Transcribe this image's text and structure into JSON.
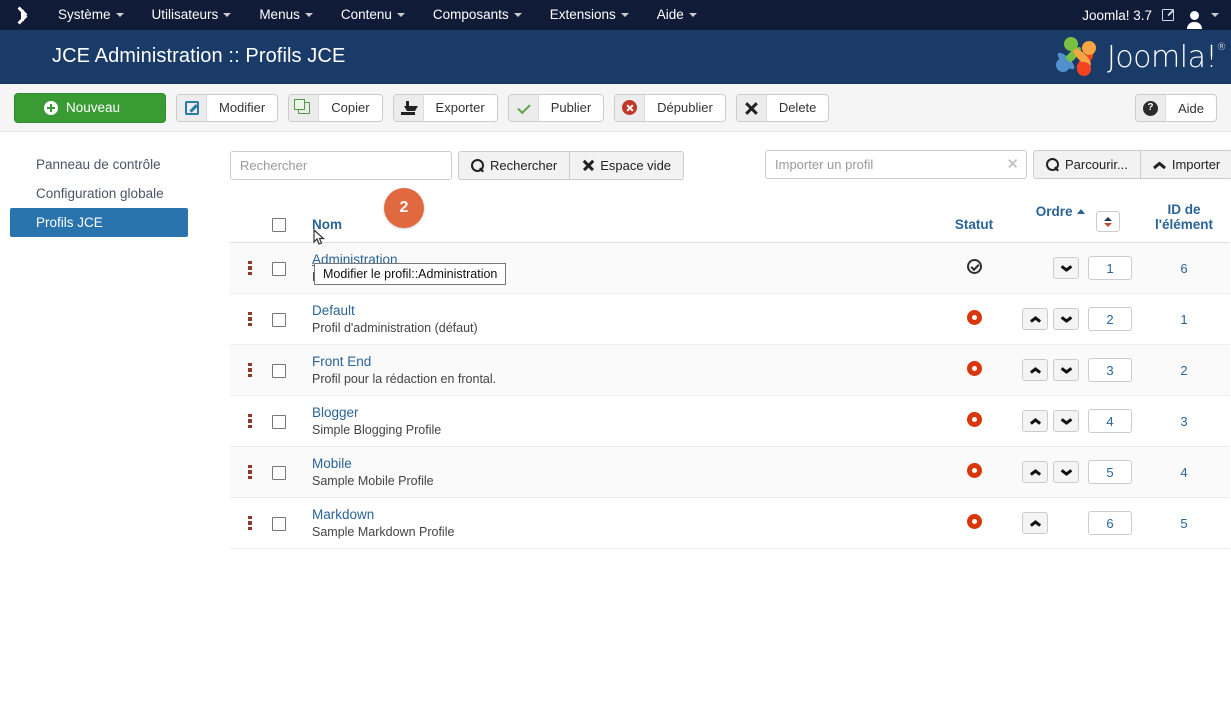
{
  "topbar": {
    "logo_icon": "joomla-icon",
    "menu": [
      {
        "label": "Système",
        "caret": true
      },
      {
        "label": "Utilisateurs",
        "caret": true
      },
      {
        "label": "Menus",
        "caret": true
      },
      {
        "label": "Contenu",
        "caret": true
      },
      {
        "label": "Composants",
        "caret": true
      },
      {
        "label": "Extensions",
        "caret": true
      },
      {
        "label": "Aide",
        "caret": true
      }
    ],
    "version": "Joomla! 3.7",
    "preview_icon": "external-link-icon",
    "user_icon": "user-icon"
  },
  "pagehead": {
    "title": "JCE Administration :: Profils JCE",
    "brand": "Joomla!",
    "brand_sup": "®"
  },
  "toolbar": {
    "new": "Nouveau",
    "edit": "Modifier",
    "copy": "Copier",
    "export": "Exporter",
    "publish": "Publier",
    "unpublish": "Dépublier",
    "delete": "Delete",
    "help": "Aide",
    "colors": {
      "new_button": "#3a9b35",
      "accent": "#2a6496"
    }
  },
  "sidebar": {
    "items": [
      {
        "label": "Panneau de contrôle",
        "active": false
      },
      {
        "label": "Configuration globale",
        "active": false
      },
      {
        "label": "Profils JCE",
        "active": true
      }
    ]
  },
  "filters": {
    "search_placeholder": "Rechercher",
    "search_value": "",
    "search_button": "Rechercher",
    "clear_button": "Espace vide",
    "import_placeholder": "Importer un profil",
    "import_value": "",
    "browse_button": "Parcourir...",
    "import_button": "Importer"
  },
  "table": {
    "headers": {
      "name": "Nom",
      "status": "Statut",
      "order": "Ordre",
      "id": "ID de l'élément"
    },
    "order_sort_direction": "asc",
    "rows": [
      {
        "name": "Administration",
        "description": "Profil pour les rédacteurs du site",
        "status": "published",
        "order": "1",
        "id": "6",
        "can_move_up": false,
        "can_move_down": true,
        "hovered": true
      },
      {
        "name": "Default",
        "description": "Profil d'administration (défaut)",
        "status": "unpublished",
        "order": "2",
        "id": "1",
        "can_move_up": true,
        "can_move_down": true,
        "hovered": false
      },
      {
        "name": "Front End",
        "description": "Profil pour la rédaction en frontal.",
        "status": "unpublished",
        "order": "3",
        "id": "2",
        "can_move_up": true,
        "can_move_down": true,
        "hovered": false
      },
      {
        "name": "Blogger",
        "description": "Simple Blogging Profile",
        "status": "unpublished",
        "order": "4",
        "id": "3",
        "can_move_up": true,
        "can_move_down": true,
        "hovered": false
      },
      {
        "name": "Mobile",
        "description": "Sample Mobile Profile",
        "status": "unpublished",
        "order": "5",
        "id": "4",
        "can_move_up": true,
        "can_move_down": true,
        "hovered": false
      },
      {
        "name": "Markdown",
        "description": "Sample Markdown Profile",
        "status": "unpublished",
        "order": "6",
        "id": "5",
        "can_move_up": true,
        "can_move_down": false,
        "hovered": false
      }
    ]
  },
  "annotations": {
    "step_badge": "2",
    "tooltip": "Modifier le profil::Administration"
  }
}
